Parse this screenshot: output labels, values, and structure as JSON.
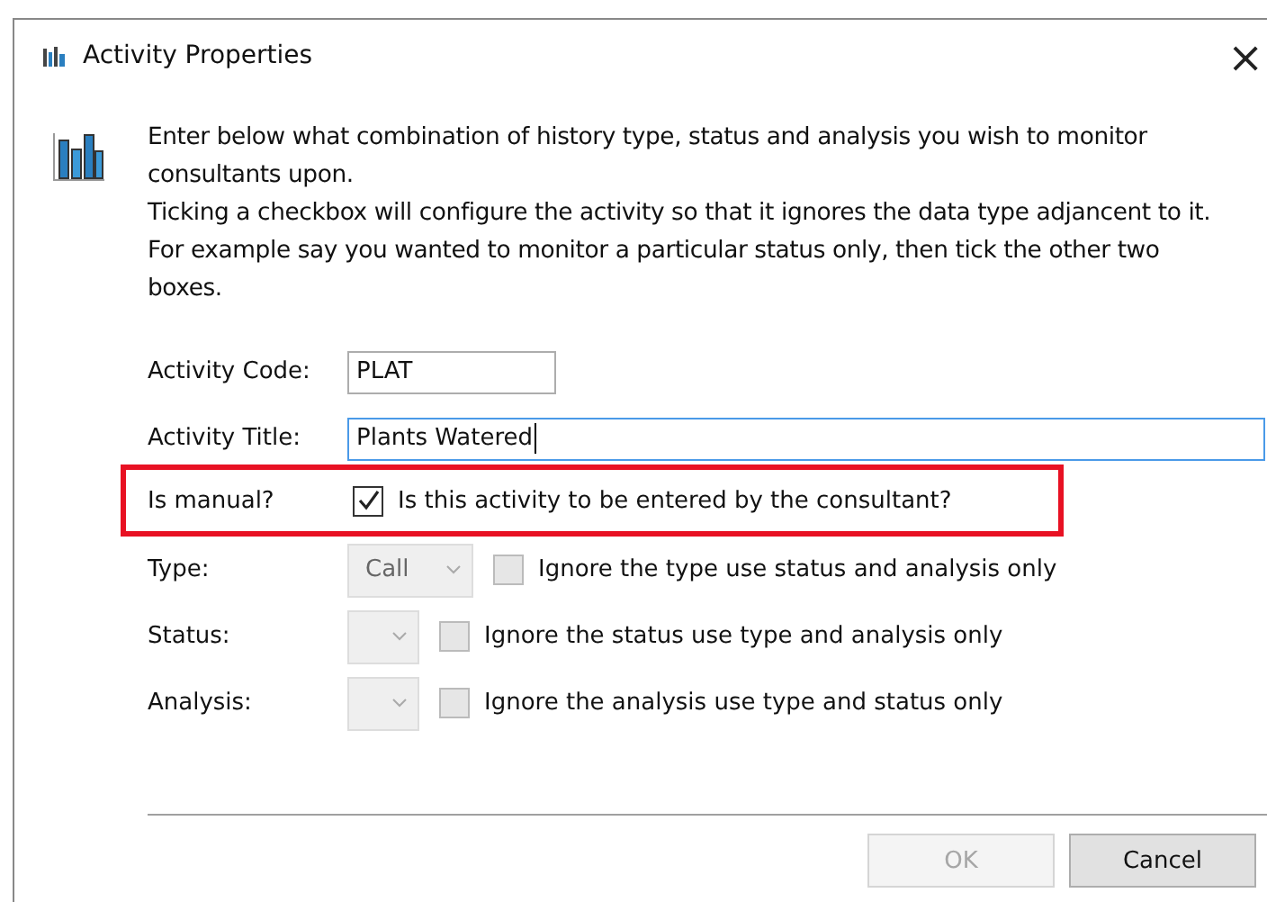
{
  "window": {
    "title": "Activity Properties",
    "close": "×"
  },
  "intro": [
    "Enter below what combination of history type, status and analysis you wish to monitor consultants upon.",
    "Ticking a checkbox will configure the activity so that it ignores the data type adjancent to it. For example say you wanted to monitor a particular status only, then tick the other two boxes."
  ],
  "fields": [
    {
      "kind": "text",
      "label": "Activity Code:",
      "value": "PLAT",
      "focused": false,
      "wide": false,
      "highlighted": false
    },
    {
      "kind": "text",
      "label": "Activity Title:",
      "value": "Plants Watered",
      "focused": true,
      "wide": true,
      "highlighted": false
    },
    {
      "kind": "check",
      "label": "Is manual?",
      "checkbox_label": "Is this activity to be entered by the consultant?",
      "checked": true,
      "highlighted": true
    },
    {
      "kind": "select",
      "label": "Type:",
      "value": "Call",
      "disabled": true,
      "checkbox_label": "Ignore the type use status and analysis only",
      "checked": false,
      "highlighted": false
    },
    {
      "kind": "select",
      "label": "Status:",
      "disabled": true,
      "checkbox_label": "Ignore the status use type and analysis only",
      "checked": false,
      "highlighted": false
    },
    {
      "kind": "select",
      "label": "Analysis:",
      "disabled": true,
      "checkbox_label": "Ignore the analysis use type and status only",
      "checked": false,
      "highlighted": false
    }
  ],
  "buttons": [
    {
      "label": "OK",
      "disabled": true
    },
    {
      "label": "Cancel",
      "disabled": false
    }
  ]
}
